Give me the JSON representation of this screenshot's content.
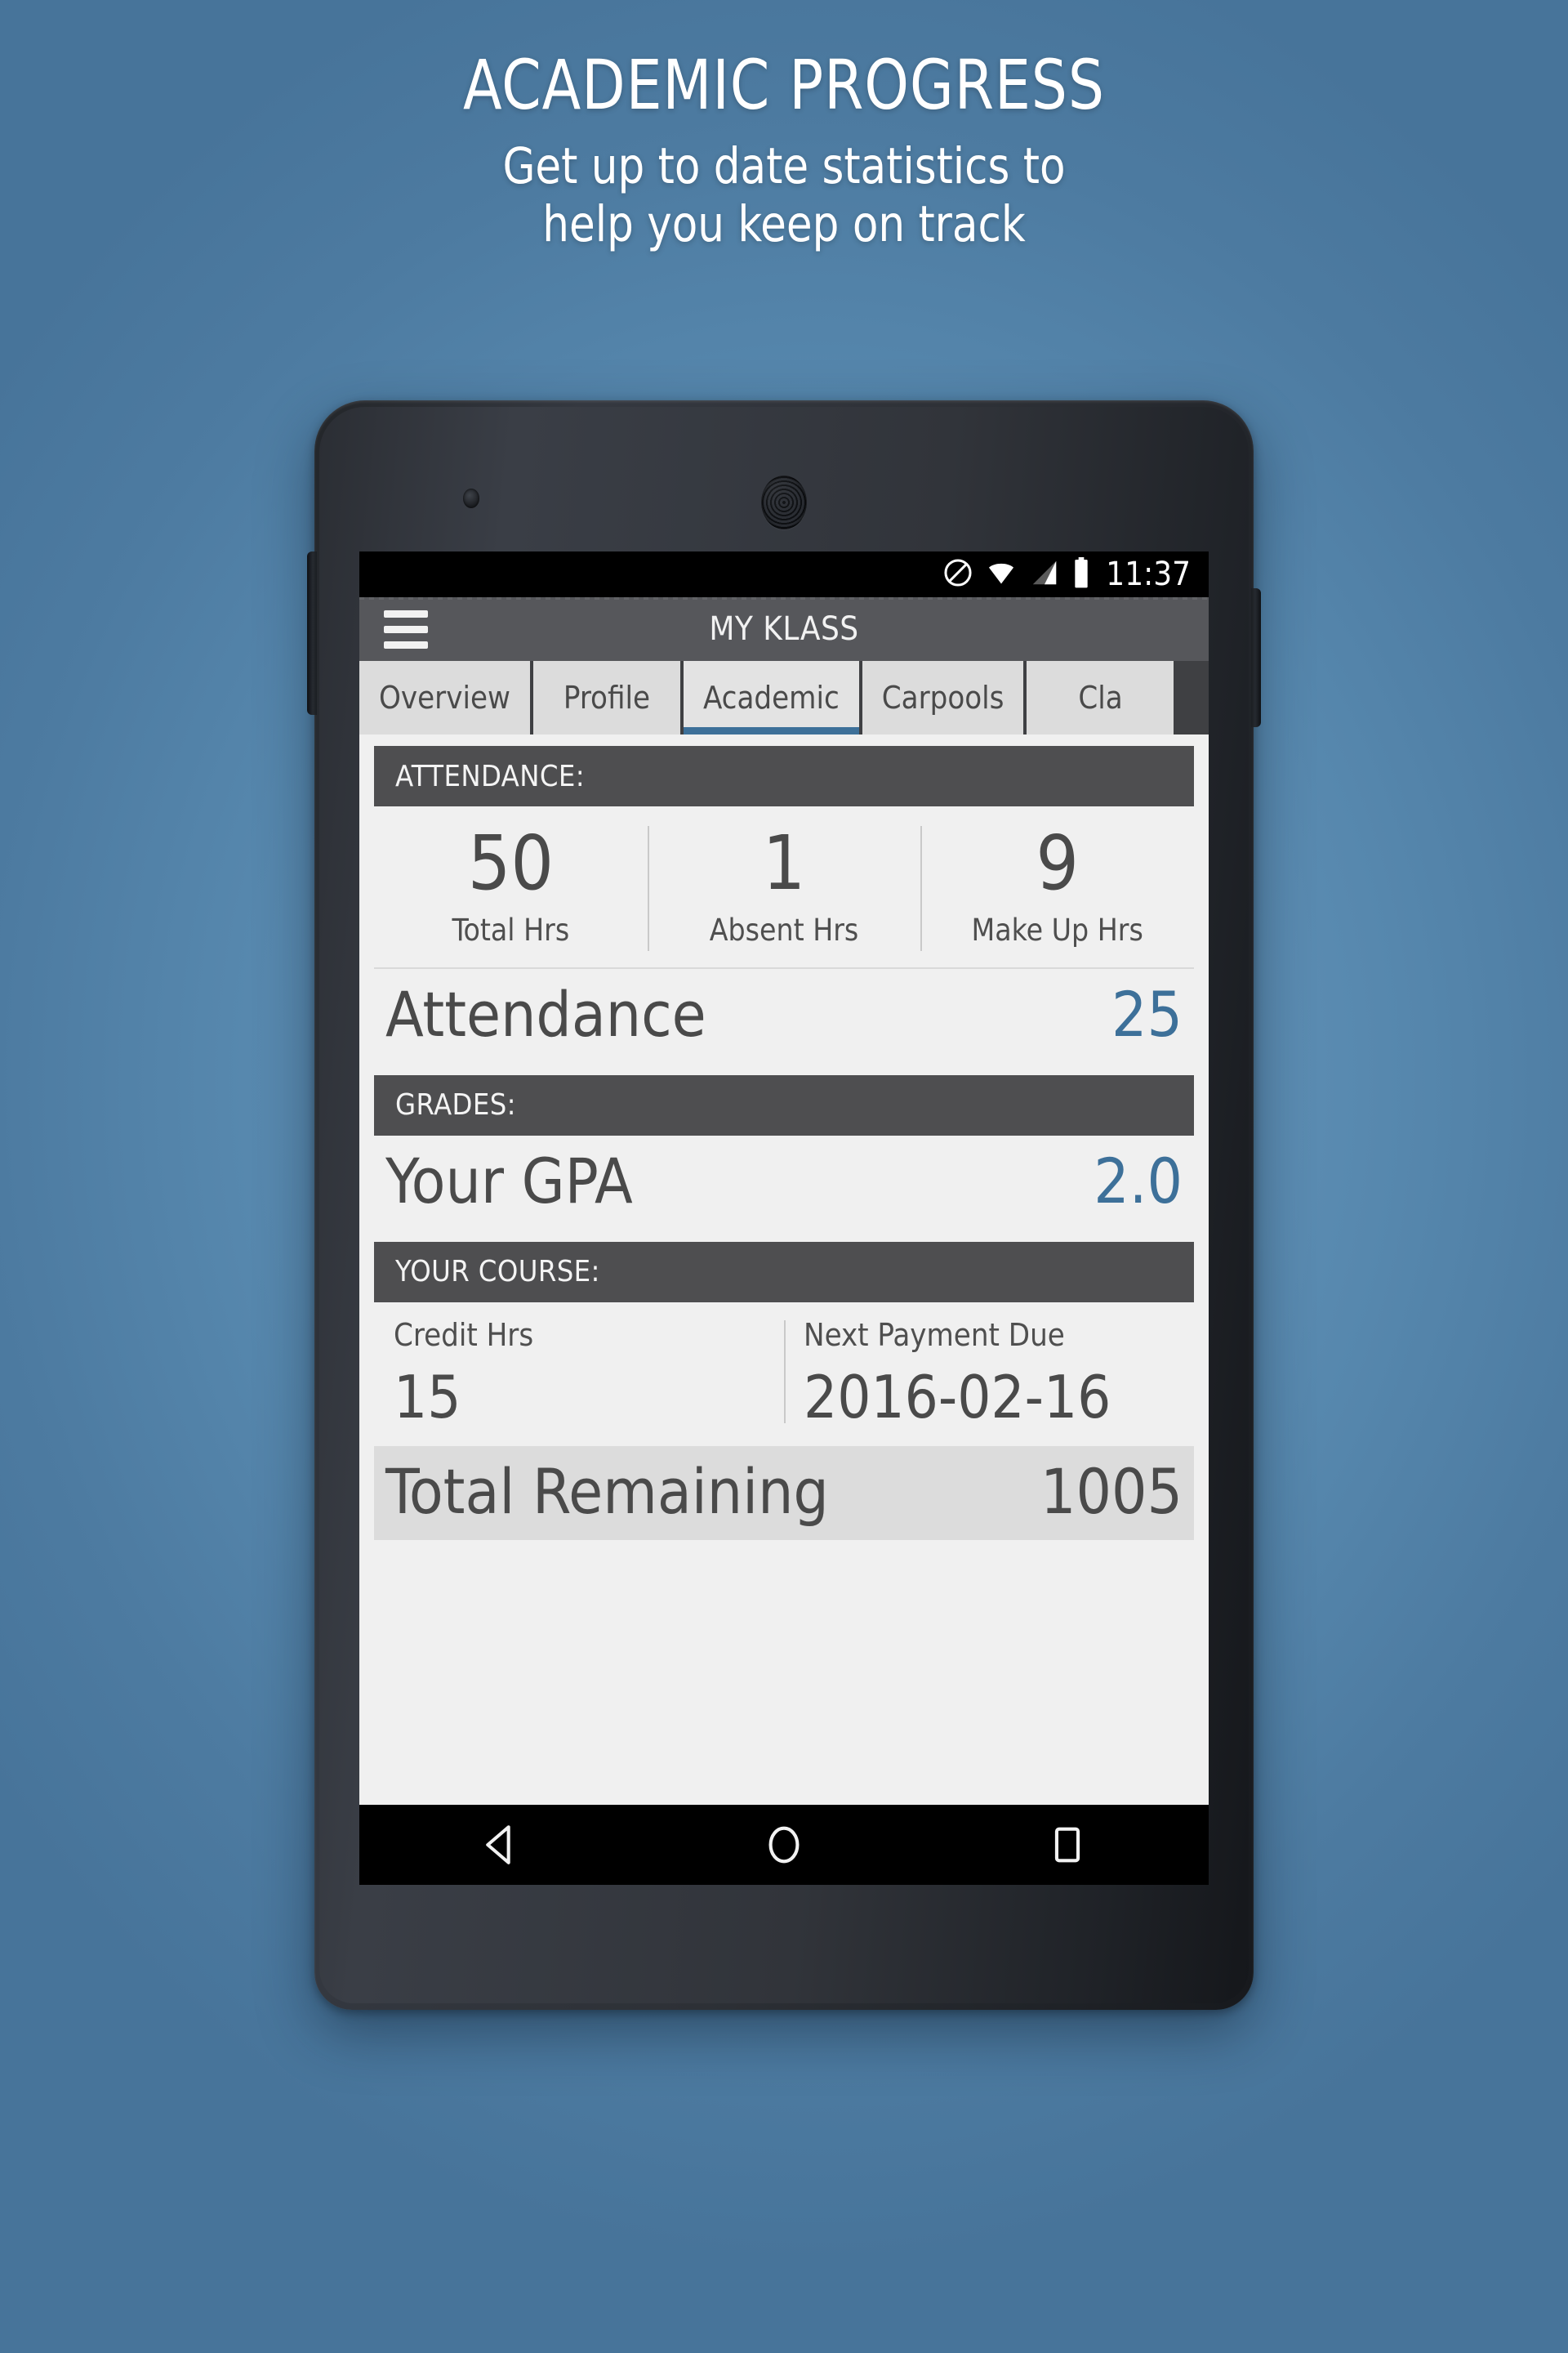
{
  "promo": {
    "title": "ACADEMIC PROGRESS",
    "subtitle_line1": "Get up to date statistics to",
    "subtitle_line2": "help you keep on track"
  },
  "colors": {
    "background_top": "#4c7ba3",
    "background_center": "#6e9ec2",
    "accent_blue": "#3d7099",
    "section_header_bg": "#4e4e50",
    "app_bar_bg": "#56575b",
    "content_bg": "#f0f0f0",
    "tab_bg": "#dcdcdc"
  },
  "phone": {
    "status_bar": {
      "time": "11:37",
      "icons": [
        "do-not-disturb-icon",
        "wifi-icon",
        "cell-signal-icon",
        "battery-icon"
      ]
    },
    "app_bar": {
      "menu_icon": "hamburger-menu-icon",
      "title": "MY KLASS"
    },
    "tabs": [
      {
        "label": "Overview",
        "active": false
      },
      {
        "label": "Profile",
        "active": false
      },
      {
        "label": "Academic",
        "active": true
      },
      {
        "label": "Carpools",
        "active": false
      },
      {
        "label": "Cla",
        "active": false
      }
    ],
    "nav_bar": {
      "back": "back-triangle-icon",
      "home": "home-circle-icon",
      "recents": "recents-square-icon"
    }
  },
  "academic": {
    "attendance_section": {
      "header": "ATTENDANCE:",
      "stats": [
        {
          "value": "50",
          "label": "Total Hrs"
        },
        {
          "value": "1",
          "label": "Absent Hrs"
        },
        {
          "value": "9",
          "label": "Make Up Hrs"
        }
      ],
      "summary": {
        "label": "Attendance",
        "value": "25"
      }
    },
    "grades_section": {
      "header": "GRADES:",
      "summary": {
        "label": "Your GPA",
        "value": "2.0"
      }
    },
    "course_section": {
      "header": "YOUR COURSE:",
      "fields": [
        {
          "label": "Credit Hrs",
          "value": "15"
        },
        {
          "label": "Next Payment Due",
          "value": "2016-02-16"
        }
      ],
      "remaining": {
        "label": "Total Remaining",
        "value": "1005"
      }
    }
  }
}
